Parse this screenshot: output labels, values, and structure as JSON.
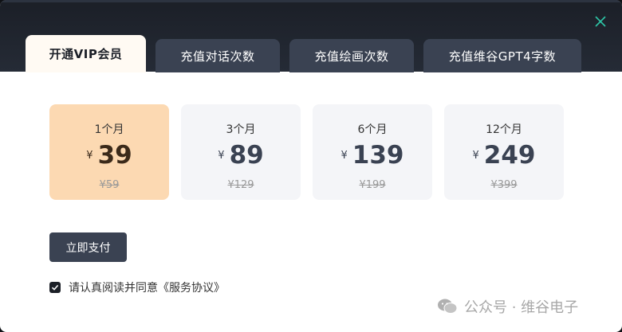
{
  "tabs": [
    {
      "label": "开通VIP会员",
      "active": true
    },
    {
      "label": "充值对话次数",
      "active": false
    },
    {
      "label": "充值绘画次数",
      "active": false
    },
    {
      "label": "充值维谷GPT4字数",
      "active": false
    }
  ],
  "plans": [
    {
      "duration": "1个月",
      "currency": "¥",
      "price": "39",
      "original": "¥59",
      "selected": true
    },
    {
      "duration": "3个月",
      "currency": "¥",
      "price": "89",
      "original": "¥129",
      "selected": false
    },
    {
      "duration": "6个月",
      "currency": "¥",
      "price": "139",
      "original": "¥199",
      "selected": false
    },
    {
      "duration": "12个月",
      "currency": "¥",
      "price": "249",
      "original": "¥399",
      "selected": false
    }
  ],
  "pay_button": "立即支付",
  "agreement": {
    "checked": true,
    "text": "请认真阅读并同意《服务协议》"
  },
  "watermark": "公众号 · 维谷电子",
  "icons": {
    "close": "close-icon",
    "check": "check-icon",
    "watermark": "wechat-icon"
  },
  "colors": {
    "header": "#1b1f27",
    "tab": "#3a4252",
    "selected_card": "#fcd9b2",
    "accent_close": "#2ec4a6"
  }
}
